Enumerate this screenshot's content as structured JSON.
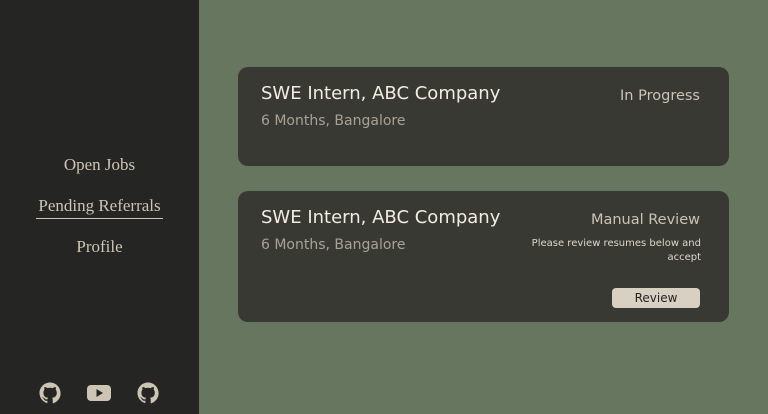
{
  "sidebar": {
    "nav": [
      {
        "label": "Open Jobs"
      },
      {
        "label": "Pending Referrals"
      },
      {
        "label": "Profile"
      }
    ],
    "social": [
      "github-icon",
      "youtube-icon",
      "github-icon"
    ]
  },
  "cards": [
    {
      "title": "SWE Intern, ABC Company",
      "subtitle": "6 Months, Bangalore",
      "status": "In Progress"
    },
    {
      "title": "SWE Intern, ABC Company",
      "subtitle": "6 Months, Bangalore",
      "status": "Manual Review",
      "note": "Please review resumes below and accept",
      "action_label": "Review"
    }
  ],
  "colors": {
    "background": "#66765f",
    "sidebar": "#252523",
    "card": "#393933",
    "text_light": "#f1ece0",
    "button": "#d8d0c3"
  }
}
